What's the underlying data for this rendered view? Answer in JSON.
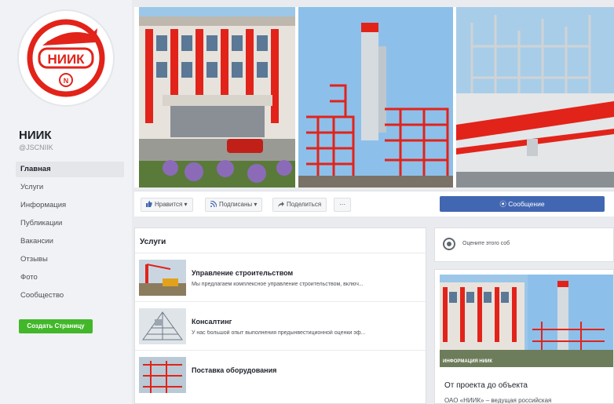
{
  "page": {
    "logo_text": "НИИК",
    "logo_badge": "N",
    "name": "НИИК",
    "handle": "@JSCNIIK"
  },
  "nav": {
    "items": [
      {
        "label": "Главная"
      },
      {
        "label": "Услуги"
      },
      {
        "label": "Информация"
      },
      {
        "label": "Публикации"
      },
      {
        "label": "Вакансии"
      },
      {
        "label": "Отзывы"
      },
      {
        "label": "Фото"
      },
      {
        "label": "Сообщество"
      }
    ],
    "create_page": "Создать Страницу"
  },
  "actions": {
    "like": "Нравится",
    "follow": "Подписаны",
    "share": "Поделиться",
    "more": "···",
    "message": "Сообщение"
  },
  "services": {
    "title": "Услуги",
    "items": [
      {
        "title": "Управление строительством",
        "desc": "Мы предлагаем комплексное управление строительством, включ..."
      },
      {
        "title": "Консалтинг",
        "desc": "У нас большой опыт выполнения предынвестиционной оценки эф..."
      },
      {
        "title": "Поставка оборудования",
        "desc": ""
      }
    ]
  },
  "right": {
    "rate_text": "Оцените этого соб",
    "info_caption": "ИНФОРМАЦИЯ НИИК",
    "info_title": "От проекта до объекта",
    "info_sub": "ОАО «НИИК» – ведущая российская"
  },
  "colors": {
    "brand_red": "#e2231a",
    "accent_blue": "#4267b2",
    "create_green": "#42b72a"
  }
}
